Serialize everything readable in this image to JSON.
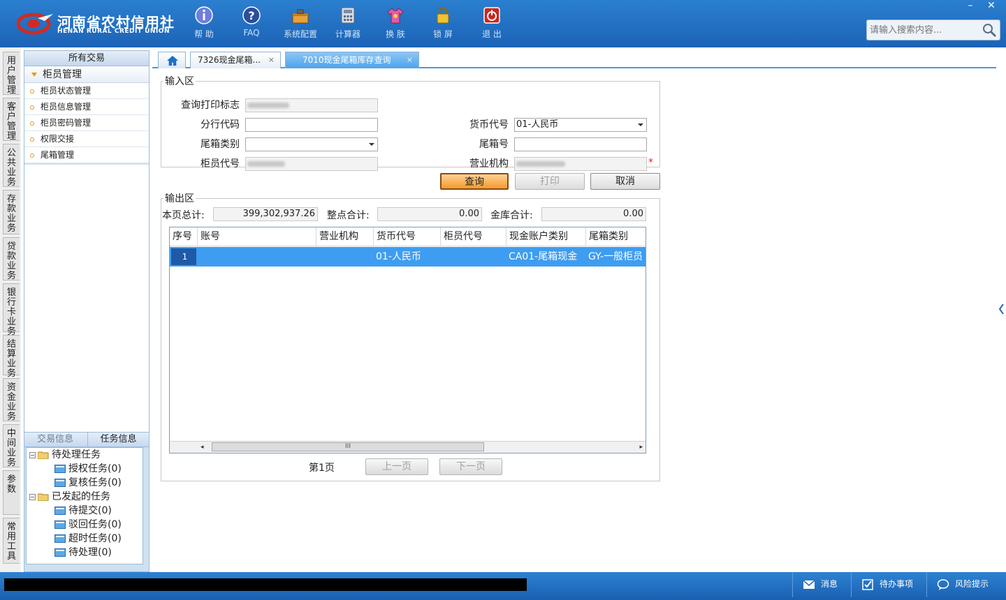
{
  "header": {
    "brand_cn": "河南省农村信用社",
    "brand_en": "HENAN RURAL CREDIT UNION",
    "tools": [
      {
        "label": "帮 助",
        "icon": "info-icon"
      },
      {
        "label": "FAQ",
        "icon": "help-icon"
      },
      {
        "label": "系统配置",
        "icon": "toolbox-icon"
      },
      {
        "label": "计算器",
        "icon": "calculator-icon"
      },
      {
        "label": "换 肤",
        "icon": "shirt-icon"
      },
      {
        "label": "锁 屏",
        "icon": "lock-icon"
      },
      {
        "label": "退 出",
        "icon": "power-icon"
      }
    ],
    "search_placeholder": "请输入搜索内容...",
    "min": "–",
    "close": "✕"
  },
  "left_tabs": [
    "用户管理",
    "客户管理",
    "公共业务",
    "存款业务",
    "贷款业务",
    "银行卡业务",
    "结算业务",
    "资金业务",
    "中间业务",
    "参数",
    "常用工具"
  ],
  "sidebar": {
    "header": "所有交易",
    "category": "柜员管理",
    "items": [
      "柜员状态管理",
      "柜员信息管理",
      "柜员密码管理",
      "权限交接",
      "尾箱管理"
    ],
    "tab_trade": "交易信息",
    "tab_task": "任务信息",
    "tree": {
      "pending": "待处理任务",
      "auth": "授权任务(0)",
      "review": "复核任务(0)",
      "initiated": "已发起的任务",
      "to_submit": "待提交(0)",
      "rejected": "驳回任务(0)",
      "timeout": "超时任务(0)",
      "to_handle": "待处理(0)"
    }
  },
  "tabs": {
    "tab1": "7326现金尾箱...",
    "tab2": "7010现金尾箱库存查询",
    "close": "×"
  },
  "input_area": {
    "legend": "输入区",
    "print_flag_label": "查询打印标志",
    "branch_code_label": "分行代码",
    "currency_label": "货币代号",
    "currency_value": "01-人民币",
    "box_type_label": "尾箱类别",
    "box_no_label": "尾箱号",
    "teller_label": "柜员代号",
    "org_label": "营业机构",
    "required": "*"
  },
  "buttons": {
    "query": "查询",
    "print": "打印",
    "cancel": "取消"
  },
  "output_area": {
    "legend": "输出区",
    "page_total_label": "本页总计:",
    "page_total": "399,302,937.26",
    "bundle_total_label": "整点合计:",
    "bundle_total": "0.00",
    "vault_total_label": "金库合计:",
    "vault_total": "0.00"
  },
  "table": {
    "columns": [
      "序号",
      "账号",
      "营业机构",
      "货币代号",
      "柜员代号",
      "现金账户类别",
      "尾箱类别"
    ],
    "rows": [
      {
        "seq": "1",
        "currency": "01-人民币",
        "cash_type": "CA01-尾箱现金",
        "box_type": "GY-一般柜员"
      }
    ],
    "scroll_mark": "III"
  },
  "pager": {
    "page": "第1页",
    "prev": "上一页",
    "next": "下一页"
  },
  "status": {
    "msg": "消息",
    "todo": "待办事项",
    "risk": "风险提示"
  }
}
